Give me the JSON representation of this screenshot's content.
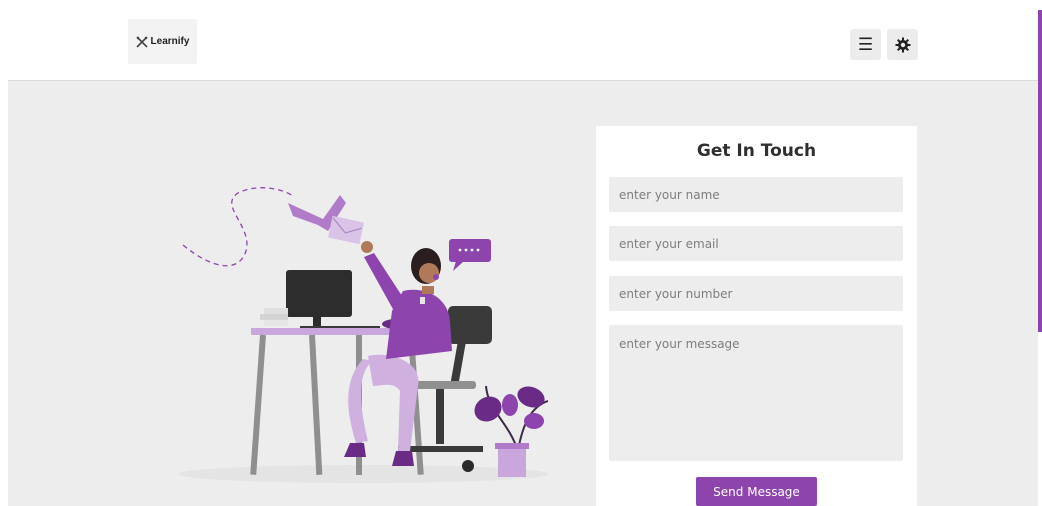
{
  "header": {
    "logo_text": "Learnify",
    "logo_icon": "crossed-tools-icon",
    "menu_icon": "menu-icon",
    "theme_icon": "gear-icon"
  },
  "contact_form": {
    "title": "Get In Touch",
    "name_placeholder": "enter your name",
    "email_placeholder": "enter your email",
    "number_placeholder": "enter your number",
    "message_placeholder": "enter your message",
    "submit_label": "Send Message"
  },
  "colors": {
    "accent": "#8e44ad",
    "background": "#ededed",
    "card": "#ffffff"
  }
}
